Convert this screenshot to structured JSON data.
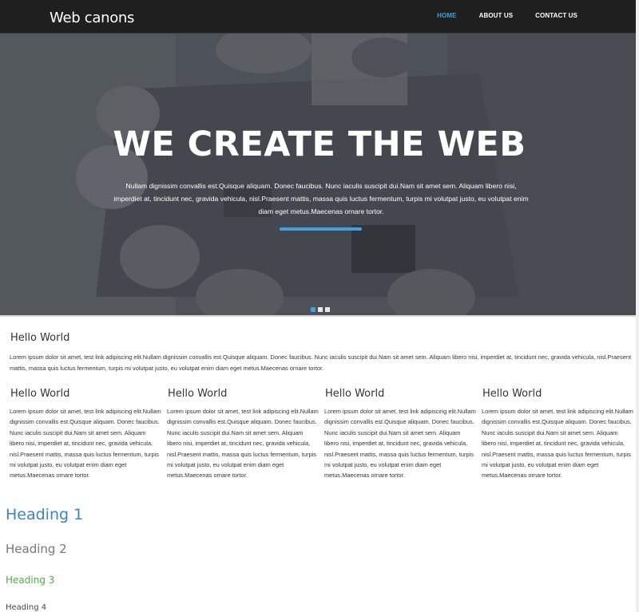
{
  "navbar": {
    "brand": "Web canons",
    "links": [
      {
        "label": "HOME",
        "active": true
      },
      {
        "label": "ABOUT US",
        "active": false
      },
      {
        "label": "CONTACT US",
        "active": false
      }
    ]
  },
  "hero": {
    "title": "WE CREATE THE WEB",
    "text": "Nullam dignissim convallis est.Quisque aliquam. Donec faucibus. Nunc iaculis suscipit dui.Nam sit amet sem. Aliquam libero nisi, imperdiet at, tincidunt nec, gravida vehicula, nisl.Praesent mattis, massa quis luctus fermentum, turpis mi volutpat justo, eu volutpat enim diam eget metus.Maecenas ornare tortor.",
    "slides": 3,
    "active_slide": 1,
    "accent_color": "#3ea3dc"
  },
  "intro": {
    "title": "Hello World",
    "text": "Lorem ipsum dolor sit amet, test link adipiscing elit.Nullam dignissim convallis est.Quisque aliquam. Donec faucibus. Nunc iaculis suscipit dui.Nam sit amet sem. Aliquam libero nisi, imperdiet at, tincidunt nec, gravida vehicula, nisl.Praesent mattis, massa quis luctus fermentum, turpis mi volutpat justo, eu volutpat enim diam eget metus.Maecenas ornare tortor."
  },
  "columns": [
    {
      "title": "Hello World",
      "text": "Lorem ipsum dolor sit amet, test link adipiscing elit.Nullam dignissim convallis est.Quisque aliquam. Donec faucibus. Nunc iaculis suscipit dui.Nam sit amet sem. Aliquam libero nisi, imperdiet at, tincidunt nec, gravida vehicula, nisl.Praesent mattis, massa quis luctus fermentum, turpis mi volutpat justo, eu volutpat enim diam eget metus.Maecenas ornare tortor."
    },
    {
      "title": "Hello World",
      "text": "Lorem ipsum dolor sit amet, test link adipiscing elit.Nullam dignissim convallis est.Quisque aliquam. Donec faucibus. Nunc iaculis suscipit dui.Nam sit amet sem. Aliquam libero nisi, imperdiet at, tincidunt nec, gravida vehicula, nisl.Praesent mattis, massa quis luctus fermentum, turpis mi volutpat justo, eu volutpat enim diam eget metus.Maecenas ornare tortor."
    },
    {
      "title": "Hello World",
      "text": "Lorem ipsum dolor sit amet, test link adipiscing elit.Nullam dignissim convallis est.Quisque aliquam. Donec faucibus. Nunc iaculis suscipit dui.Nam sit amet sem. Aliquam libero nisi, imperdiet at, tincidunt nec, gravida vehicula, nisl.Praesent mattis, massa quis luctus fermentum, turpis mi volutpat justo, eu volutpat enim diam eget metus.Maecenas ornare tortor."
    },
    {
      "title": "Hello World",
      "text": "Lorem ipsum dolor sit amet, test link adipiscing elit.Nullam dignissim convallis est.Quisque aliquam. Donec faucibus. Nunc iaculis suscipit dui.Nam sit amet sem. Aliquam libero nisi, imperdiet at, tincidunt nec, gravida vehicula, nisl.Praesent mattis, massa quis luctus fermentum, turpis mi volutpat justo, eu volutpat enim diam eget metus.Maecenas ornare tortor."
    }
  ],
  "headings": {
    "h1": "Heading 1",
    "h2": "Heading 2",
    "h3": "Heading 3",
    "h4": "Heading 4"
  },
  "colors": {
    "navbar_bg": "#1f1f1f",
    "accent": "#3ea3dc",
    "heading1": "#3a84c5",
    "heading2": "#777777",
    "heading3": "#4cae4c"
  }
}
